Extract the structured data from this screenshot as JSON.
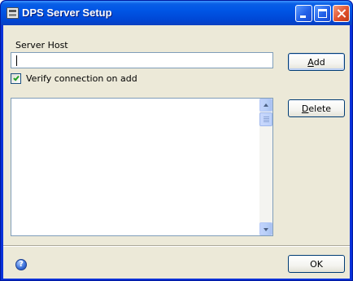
{
  "window": {
    "title": "DPS Server Setup",
    "icon": "app-window-icon"
  },
  "form": {
    "server_host_label": "Server Host",
    "server_host_value": "",
    "verify_label": "Verify connection on add",
    "verify_checked": true
  },
  "buttons": {
    "add_label": "Add",
    "add_mnemonic": "A",
    "delete_label": "Delete",
    "delete_mnemonic": "D",
    "ok_label": "OK"
  },
  "server_list": {
    "items": []
  },
  "footer": {
    "help_icon": "help-icon",
    "help_glyph": "?"
  },
  "colors": {
    "titlebar": "#0055e5",
    "client_bg": "#ece9d8",
    "checkmark": "#21a121"
  }
}
